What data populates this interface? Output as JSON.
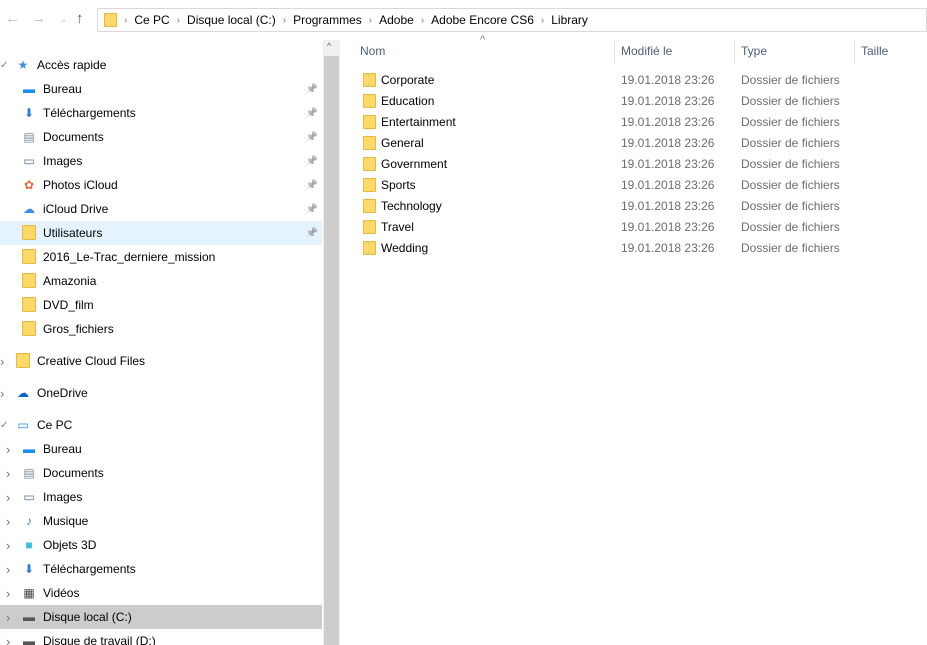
{
  "address": {
    "crumbs": [
      "Ce PC",
      "Disque local (C:)",
      "Programmes",
      "Adobe",
      "Adobe Encore CS6",
      "Library"
    ]
  },
  "nav": {
    "quick": {
      "label": "Accès rapide",
      "items": [
        {
          "label": "Bureau",
          "icon": "desktop-icon",
          "pinned": true
        },
        {
          "label": "Téléchargements",
          "icon": "download-icon",
          "pinned": true
        },
        {
          "label": "Documents",
          "icon": "documents-icon",
          "pinned": true
        },
        {
          "label": "Images",
          "icon": "images-icon",
          "pinned": true
        },
        {
          "label": "Photos iCloud",
          "icon": "photos-icloud-icon",
          "pinned": true
        },
        {
          "label": "iCloud Drive",
          "icon": "icloud-drive-icon",
          "pinned": true
        },
        {
          "label": "Utilisateurs",
          "icon": "folder-icon",
          "pinned": true
        },
        {
          "label": "2016_Le-Trac_derniere_mission",
          "icon": "folder-icon",
          "pinned": false
        },
        {
          "label": "Amazonia",
          "icon": "folder-icon",
          "pinned": false
        },
        {
          "label": "DVD_film",
          "icon": "folder-icon",
          "pinned": false
        },
        {
          "label": "Gros_fichiers",
          "icon": "folder-icon",
          "pinned": false
        }
      ]
    },
    "creative_cloud": "Creative Cloud Files",
    "onedrive": "OneDrive",
    "pc": {
      "label": "Ce PC",
      "items": [
        {
          "label": "Bureau",
          "icon": "desktop-icon"
        },
        {
          "label": "Documents",
          "icon": "documents-icon"
        },
        {
          "label": "Images",
          "icon": "images-icon"
        },
        {
          "label": "Musique",
          "icon": "music-icon"
        },
        {
          "label": "Objets 3D",
          "icon": "objects-3d-icon"
        },
        {
          "label": "Téléchargements",
          "icon": "download-icon"
        },
        {
          "label": "Vidéos",
          "icon": "videos-icon"
        },
        {
          "label": "Disque local (C:)",
          "icon": "drive-icon"
        },
        {
          "label": "Disque de travail (D:)",
          "icon": "drive-icon"
        }
      ]
    }
  },
  "columns": {
    "name": "Nom",
    "modified": "Modifié le",
    "type": "Type",
    "size": "Taille"
  },
  "files": [
    {
      "name": "Corporate",
      "modified": "19.01.2018 23:26",
      "type": "Dossier de fichiers"
    },
    {
      "name": "Education",
      "modified": "19.01.2018 23:26",
      "type": "Dossier de fichiers"
    },
    {
      "name": "Entertainment",
      "modified": "19.01.2018 23:26",
      "type": "Dossier de fichiers"
    },
    {
      "name": "General",
      "modified": "19.01.2018 23:26",
      "type": "Dossier de fichiers"
    },
    {
      "name": "Government",
      "modified": "19.01.2018 23:26",
      "type": "Dossier de fichiers"
    },
    {
      "name": "Sports",
      "modified": "19.01.2018 23:26",
      "type": "Dossier de fichiers"
    },
    {
      "name": "Technology",
      "modified": "19.01.2018 23:26",
      "type": "Dossier de fichiers"
    },
    {
      "name": "Travel",
      "modified": "19.01.2018 23:26",
      "type": "Dossier de fichiers"
    },
    {
      "name": "Wedding",
      "modified": "19.01.2018 23:26",
      "type": "Dossier de fichiers"
    }
  ]
}
